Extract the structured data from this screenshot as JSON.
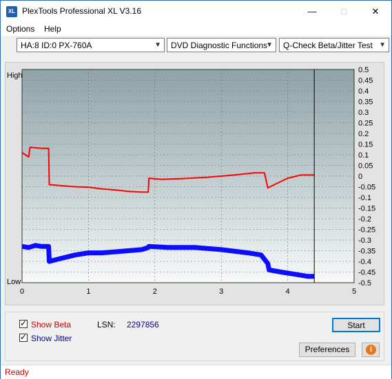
{
  "window": {
    "title": "PlexTools Professional XL V3.16",
    "icon_text": "XL"
  },
  "menu": {
    "items": [
      "Options",
      "Help"
    ]
  },
  "toolbar": {
    "drive": "HA:8 ID:0  PX-760A",
    "category": "DVD Diagnostic Functions",
    "test": "Q-Check Beta/Jitter Test"
  },
  "chart": {
    "y_high_label": "High",
    "y_low_label": "Low",
    "x_ticks": [
      "0",
      "1",
      "2",
      "3",
      "4",
      "5"
    ],
    "right_ticks": [
      "0.5",
      "0.45",
      "0.4",
      "0.35",
      "0.3",
      "0.25",
      "0.2",
      "0.15",
      "0.1",
      "0.05",
      "0",
      "-0.05",
      "-0.1",
      "-0.15",
      "-0.2",
      "-0.25",
      "-0.3",
      "-0.35",
      "-0.4",
      "-0.45",
      "-0.5"
    ]
  },
  "chart_data": {
    "type": "line",
    "xlim": [
      0,
      5
    ],
    "ylim": [
      -0.5,
      0.5
    ],
    "end_marker_x": 4.4,
    "series": [
      {
        "color": "#ff0000",
        "x": [
          0,
          0.1,
          0.12,
          0.3,
          0.4,
          0.41,
          0.6,
          0.8,
          1.0,
          1.2,
          1.4,
          1.6,
          1.8,
          1.9,
          1.91,
          2.1,
          2.4,
          2.8,
          3.2,
          3.5,
          3.65,
          3.7,
          3.8,
          4.0,
          4.2,
          4.4
        ],
        "values": [
          0.11,
          0.09,
          0.135,
          0.13,
          0.13,
          -0.04,
          -0.045,
          -0.05,
          -0.052,
          -0.06,
          -0.065,
          -0.072,
          -0.075,
          -0.075,
          -0.01,
          -0.015,
          -0.012,
          -0.005,
          0.005,
          0.015,
          0.015,
          -0.055,
          -0.04,
          -0.01,
          0.005,
          0.005
        ]
      },
      {
        "color": "#0000ff",
        "x": [
          0,
          0.1,
          0.2,
          0.3,
          0.4,
          0.41,
          0.6,
          0.8,
          1.0,
          1.2,
          1.4,
          1.6,
          1.8,
          1.9,
          1.91,
          2.2,
          2.6,
          3.0,
          3.4,
          3.6,
          3.7,
          3.72,
          3.9,
          4.1,
          4.3,
          4.4
        ],
        "values": [
          -0.33,
          -0.335,
          -0.325,
          -0.33,
          -0.33,
          -0.4,
          -0.385,
          -0.37,
          -0.36,
          -0.36,
          -0.355,
          -0.35,
          -0.345,
          -0.335,
          -0.33,
          -0.335,
          -0.335,
          -0.345,
          -0.36,
          -0.37,
          -0.41,
          -0.44,
          -0.45,
          -0.46,
          -0.47,
          -0.47
        ]
      }
    ]
  },
  "panel": {
    "show_beta": "Show Beta",
    "show_jitter": "Show Jitter",
    "lsn_label": "LSN:",
    "lsn_value": "2297856",
    "start": "Start",
    "preferences": "Preferences"
  },
  "status": {
    "text": "Ready"
  },
  "colors": {
    "beta": "#ff0000",
    "jitter": "#0000ff",
    "status_text": "#c00000"
  }
}
